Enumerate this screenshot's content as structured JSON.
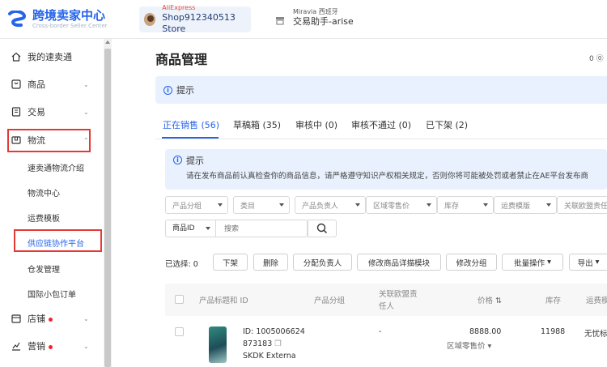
{
  "brand": {
    "title": "跨境卖家中心",
    "subtitle": "Cross-border Seller Center"
  },
  "store": {
    "platform": "AliExpress",
    "name": "Shop912340513 Store"
  },
  "miravia": {
    "line1": "Miravia 西班牙",
    "line2": "交易助手-arise"
  },
  "sidebar": {
    "items": [
      {
        "label": "我的速卖通",
        "icon": "home-icon"
      },
      {
        "label": "商品",
        "icon": "product-icon"
      },
      {
        "label": "交易",
        "icon": "order-icon"
      },
      {
        "label": "物流",
        "icon": "logistics-icon"
      }
    ],
    "logistics_sub": [
      "速卖通物流介绍",
      "物流中心",
      "运费模板",
      "供应链协作平台",
      "仓发管理",
      "国际小包订单"
    ],
    "bottom_items": [
      {
        "label": "店铺",
        "icon": "store-icon"
      },
      {
        "label": "营销",
        "icon": "marketing-icon"
      }
    ]
  },
  "main": {
    "title": "商品管理",
    "help_count": "0",
    "tip_label": "提示",
    "tabs": [
      "正在销售 (56)",
      "草稿箱 (35)",
      "审核中 (0)",
      "审核不通过 (0)",
      "已下架 (2)"
    ],
    "notice_title": "提示",
    "notice_body": "请在发布商品前认真检查你的商品信息，请严格遵守知识产权相关规定，否则你将可能被处罚或者禁止在AE平台发布商",
    "filters": [
      "产品分组",
      "类目",
      "产品负责人",
      "区域零售价",
      "库存",
      "运费模版",
      "关联欧盟责任"
    ],
    "search_select": "商品ID",
    "search_placeholder": "搜索",
    "selected_label": "已选择: 0",
    "actions": [
      "下架",
      "删除",
      "分配负责人",
      "修改商品详描模块",
      "修改分组",
      "批量操作",
      "导出"
    ],
    "columns": {
      "title": "产品标题和 ID",
      "group": "产品分组",
      "eu_line1": "关联欧盟责",
      "eu_line2": "任人",
      "price": "价格",
      "stock": "库存",
      "shipping": "运费模"
    },
    "row": {
      "id_line1": "ID: 1005006624",
      "id_line2": "873183",
      "name": "SKDK Externa",
      "eu": "-",
      "price": "8888.00",
      "price_note": "区域零售价",
      "stock": "11988",
      "shipping": "无忧标"
    }
  },
  "colors": {
    "accent": "#2563eb",
    "highlight_border": "#e53935",
    "badge": "#f5222d"
  }
}
